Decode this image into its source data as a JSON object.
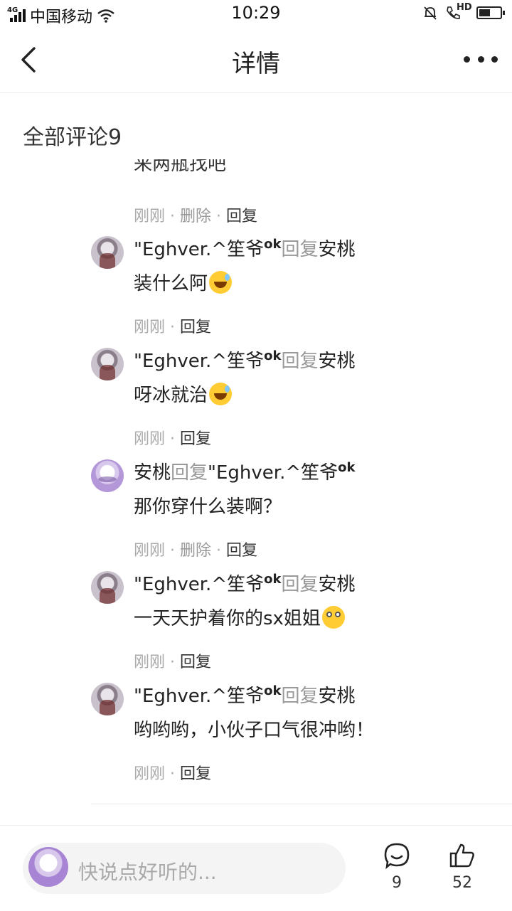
{
  "status_bar": {
    "network": "4G",
    "carrier": "中国移动",
    "time": "10:29",
    "hd": "HD",
    "battery_level": 0.55
  },
  "header": {
    "title": "详情",
    "back_icon": "chevron-left-icon",
    "more_icon": "more-dots-icon"
  },
  "section": {
    "title": "全部评论9"
  },
  "partial_comment": {
    "text": "来两瓶找吧",
    "meta": {
      "time": "刚刚",
      "delete": "删除",
      "reply": "回复",
      "sep": "·"
    }
  },
  "comments": [
    {
      "author": "\"Eghver.^笙爷",
      "author_sup": "ok",
      "reply_word": "回复",
      "target": "安桃",
      "target_sup": "",
      "text": "装什么阿",
      "emoji": "grinning-sweat-emoji",
      "meta": {
        "time": "刚刚",
        "delete": "",
        "reply": "回复"
      }
    },
    {
      "author": "\"Eghver.^笙爷",
      "author_sup": "ok",
      "reply_word": "回复",
      "target": "安桃",
      "target_sup": "",
      "text": "呀冰就治",
      "emoji": "grinning-sweat-emoji",
      "meta": {
        "time": "刚刚",
        "delete": "",
        "reply": "回复"
      }
    },
    {
      "author": "安桃",
      "author_sup": "",
      "reply_word": "回复",
      "target": "\"Eghver.^笙爷",
      "target_sup": "ok",
      "text": "那你穿什么装啊？",
      "emoji": "",
      "meta": {
        "time": "刚刚",
        "delete": "删除",
        "reply": "回复"
      }
    },
    {
      "author": "\"Eghver.^笙爷",
      "author_sup": "ok",
      "reply_word": "回复",
      "target": "安桃",
      "target_sup": "",
      "text": "一天天护着你的sx姐姐",
      "emoji": "eye-roll-emoji",
      "meta": {
        "time": "刚刚",
        "delete": "",
        "reply": "回复"
      }
    },
    {
      "author": "\"Eghver.^笙爷",
      "author_sup": "ok",
      "reply_word": "回复",
      "target": "安桃",
      "target_sup": "",
      "text": "哟哟哟，小伙子口气很冲哟！",
      "emoji": "",
      "meta": {
        "time": "刚刚",
        "delete": "",
        "reply": "回复"
      }
    }
  ],
  "bottom_bar": {
    "input_placeholder": "快说点好听的...",
    "comment_count": "9",
    "like_count": "52"
  }
}
